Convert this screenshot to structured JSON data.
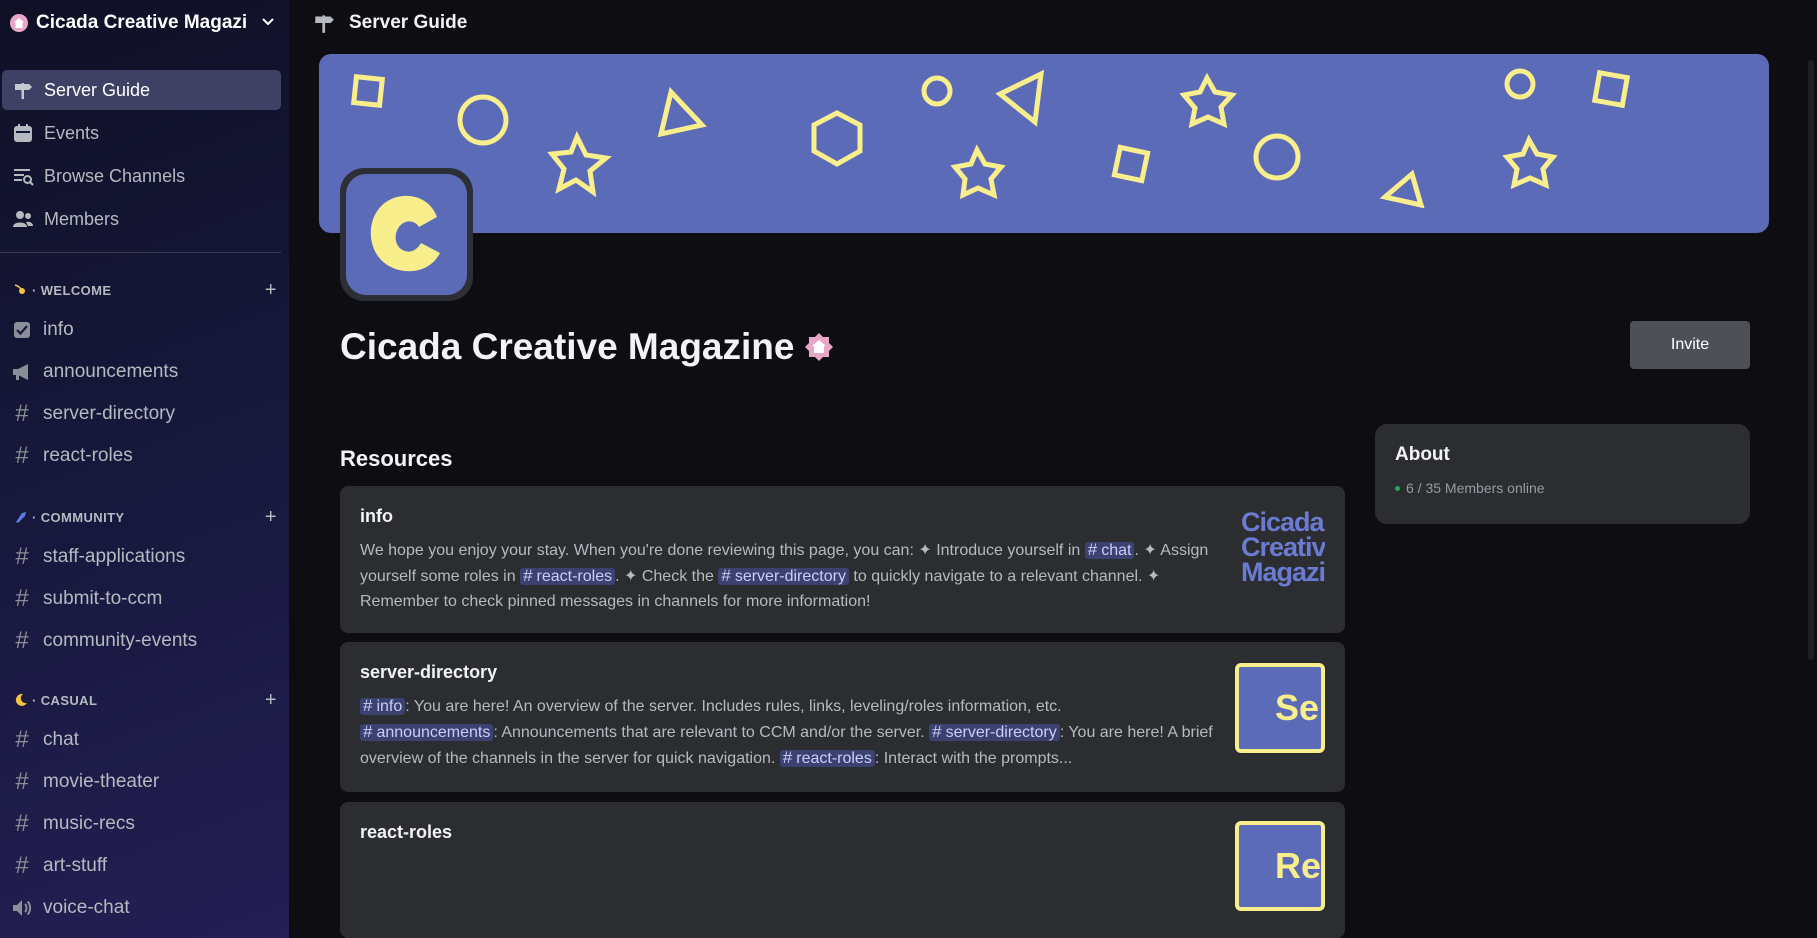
{
  "server": {
    "name": "Cicada Creative Magazi",
    "full_name": "Cicada Creative Magazine"
  },
  "topbar": {
    "title": "Server Guide",
    "icon": "signpost-icon"
  },
  "nav": [
    {
      "label": "Server Guide",
      "icon": "signpost-icon",
      "active": true
    },
    {
      "label": "Events",
      "icon": "calendar-icon"
    },
    {
      "label": "Browse Channels",
      "icon": "browse-channels-icon"
    },
    {
      "label": "Members",
      "icon": "members-icon"
    }
  ],
  "categories": [
    {
      "name": "· WELCOME",
      "channels": [
        "info",
        "announcements",
        "server-directory",
        "react-roles"
      ]
    },
    {
      "name": "· COMMUNITY",
      "channels": [
        "staff-applications",
        "submit-to-ccm",
        "community-events"
      ]
    },
    {
      "name": "· CASUAL",
      "channels": [
        "chat",
        "movie-theater",
        "music-recs",
        "art-stuff",
        "voice-chat"
      ]
    }
  ],
  "main": {
    "invite_label": "Invite",
    "resources_heading": "Resources",
    "cards": [
      {
        "title": "info",
        "body": [
          "We hope you enjoy your stay. When you're done reviewing this page, you can: ✦ Introduce yourself in ",
          "chat",
          ". ✦ Assign yourself some roles in ",
          "react-roles",
          ". ✦ Check the ",
          "server-directory",
          " to quickly navigate to a relevant channel. ✦ Remember to check pinned messages in channels for more information!"
        ],
        "thumb_text": "Cicada Creative Magazine"
      },
      {
        "title": "server-directory",
        "body": [
          "info",
          ": You are here! An overview of the server. Includes rules, links, leveling/roles information, etc.",
          "announcements",
          ": Announcements that are relevant to CCM and/or the server. ",
          "server-directory",
          ": You are here! A brief overview of the channels in the server for quick navigation. ",
          "react-roles",
          ": Interact with the prompts..."
        ],
        "thumb_text": "Serv"
      },
      {
        "title": "react-roles",
        "thumb_text": "Rea"
      }
    ],
    "about": {
      "title": "About",
      "online": "6 / 35 Members online"
    }
  },
  "colors": {
    "accent": "#5c6bb8",
    "yellow": "#f8ee8c",
    "pink": "#e8a6c9",
    "online": "#23a55a"
  }
}
